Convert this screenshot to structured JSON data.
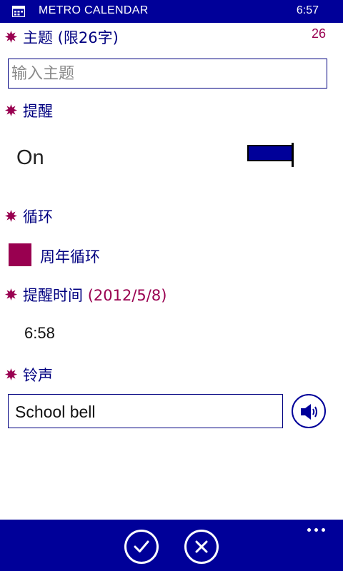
{
  "status_bar": {
    "app_title": "METRO CALENDAR",
    "time": "6:57"
  },
  "subject": {
    "label": "主题 (限26字)",
    "remaining": "26",
    "placeholder": "输入主题",
    "value": ""
  },
  "reminder": {
    "label": "提醒",
    "state": "On",
    "enabled": true
  },
  "repeat": {
    "label": "循环",
    "option_label": "周年循环",
    "checked": true
  },
  "reminder_time": {
    "label": "提醒时间",
    "date": "(2012/5/8)",
    "time": "6:58"
  },
  "ringtone": {
    "label": "铃声",
    "value": "School bell"
  },
  "app_bar": {
    "icons": [
      "check-icon",
      "close-icon",
      "more-icon"
    ]
  },
  "colors": {
    "primary": "#000099",
    "label_text": "#000080",
    "accent": "#990050",
    "background": "#ffffff"
  }
}
